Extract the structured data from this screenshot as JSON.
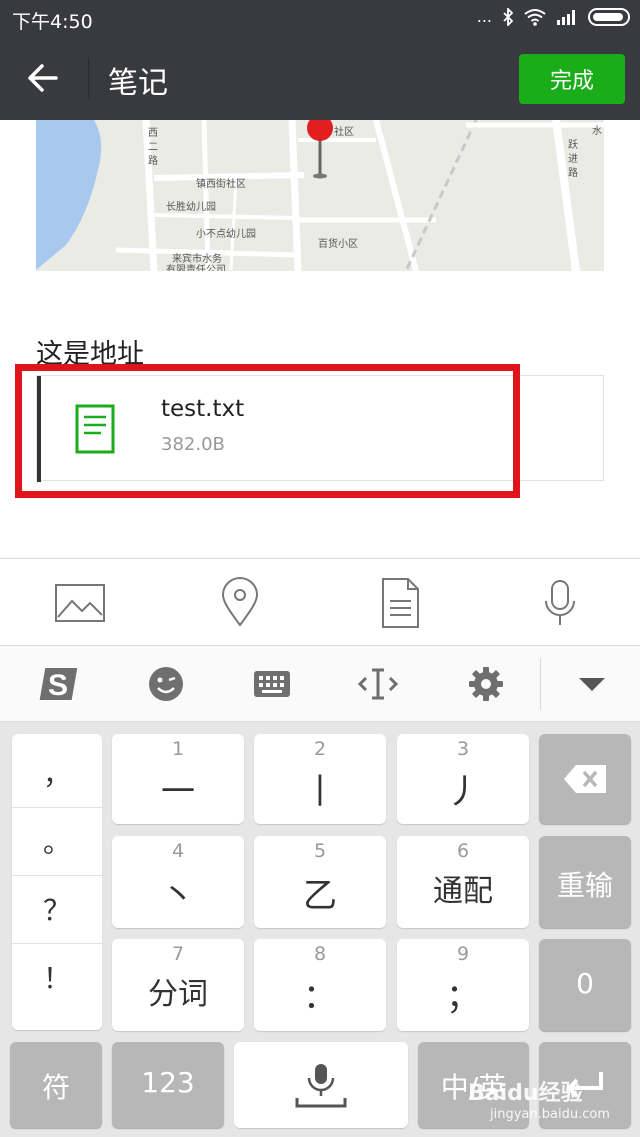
{
  "status_bar": {
    "time": "下午4:50",
    "signal_dots": "..."
  },
  "app_bar": {
    "title": "笔记",
    "done_label": "完成"
  },
  "map": {
    "labels": [
      "西",
      "二",
      "路",
      "镇西街社区",
      "长胜幼儿园",
      "小不点幼儿园",
      "百货小区",
      "来宾市水务",
      "有限责任公司",
      "社区",
      "跃",
      "进",
      "路",
      "水"
    ]
  },
  "note": {
    "address_text": "这是地址"
  },
  "file_card": {
    "name": "test.txt",
    "size": "382.0B",
    "icon": "document-icon",
    "icon_color": "#1aad19"
  },
  "highlight": {
    "color": "#e0141b"
  },
  "attach_bar": {
    "icons": [
      "image-icon",
      "location-pin-icon",
      "file-icon",
      "microphone-icon"
    ]
  },
  "ime_bar": {
    "icons": [
      "sogou-logo-icon",
      "emoji-icon",
      "keyboard-icon",
      "cursor-move-icon",
      "gear-icon",
      "chevron-down-icon"
    ]
  },
  "keyboard": {
    "punctuation": [
      "，",
      "。",
      "？",
      "！"
    ],
    "keys": [
      {
        "num": "1",
        "main": "一"
      },
      {
        "num": "2",
        "main": "丨"
      },
      {
        "num": "3",
        "main": "丿"
      },
      {
        "num": "4",
        "main": "丶"
      },
      {
        "num": "5",
        "main": "乙"
      },
      {
        "num": "6",
        "main": "通配"
      },
      {
        "num": "7",
        "main": "分词"
      },
      {
        "num": "8",
        "main": "："
      },
      {
        "num": "9",
        "main": "；"
      }
    ],
    "backspace_icon": "backspace-icon",
    "retype_label": "重输",
    "zero_label": "0",
    "symbol_label": "符",
    "num_label": "123",
    "lang_label": "中/英",
    "enter_icon": "enter-icon",
    "space_icon": "microphone-space-icon"
  },
  "watermark": {
    "brand": "Baidu经验",
    "url": "jingyan.baidu.com"
  },
  "colors": {
    "appbar_bg": "#393a3f",
    "accent_green": "#1aad19",
    "keyboard_bg": "#e6e6e6"
  }
}
